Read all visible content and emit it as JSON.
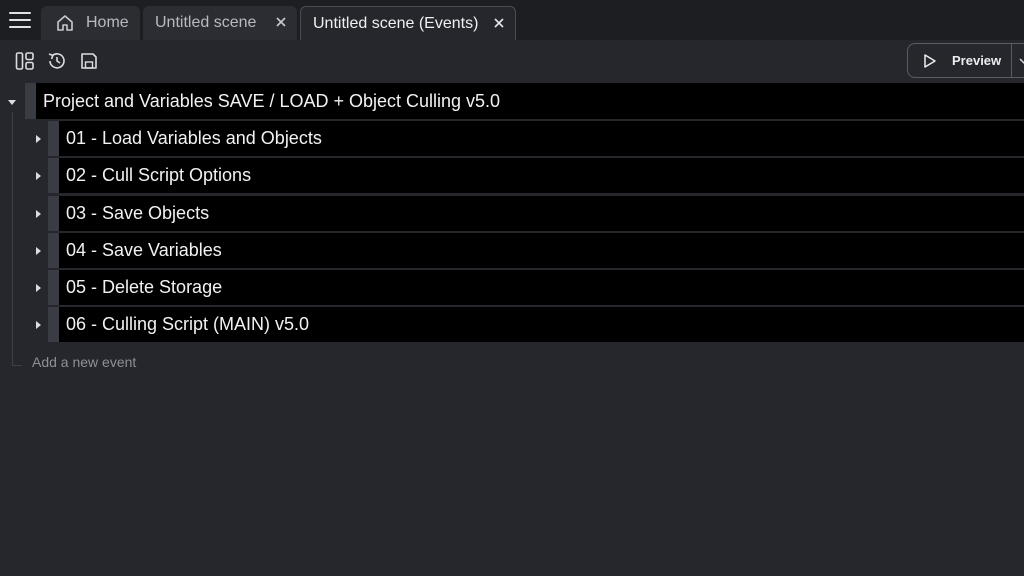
{
  "tabs": {
    "home_label": "Home",
    "scene_label": "Untitled scene",
    "events_label": "Untitled scene (Events)"
  },
  "toolbar": {
    "preview_label": "Preview"
  },
  "events": {
    "group_title": "Project and Variables SAVE / LOAD + Object Culling v5.0",
    "children": [
      {
        "title": "01 - Load Variables and Objects"
      },
      {
        "title": "02 - Cull Script Options"
      },
      {
        "title": "03 - Save Objects"
      },
      {
        "title": "04 - Save Variables"
      },
      {
        "title": "05 - Delete Storage"
      },
      {
        "title": "06 - Culling Script (MAIN) v5.0"
      }
    ],
    "add_event_label": "Add a new event"
  },
  "icons": {
    "menu": "hamburger-menu-icon",
    "home": "home-icon",
    "close": "close-icon",
    "panels": "panels-layout-icon",
    "history": "history-icon",
    "save": "save-icon",
    "play": "play-icon",
    "chevron": "chevron-down-icon",
    "expand": "expand-arrow-icon",
    "collapse": "collapse-arrow-icon"
  },
  "colors": {
    "background": "#25272d",
    "tabbar": "#1c1e22",
    "event_row": "#000000"
  }
}
